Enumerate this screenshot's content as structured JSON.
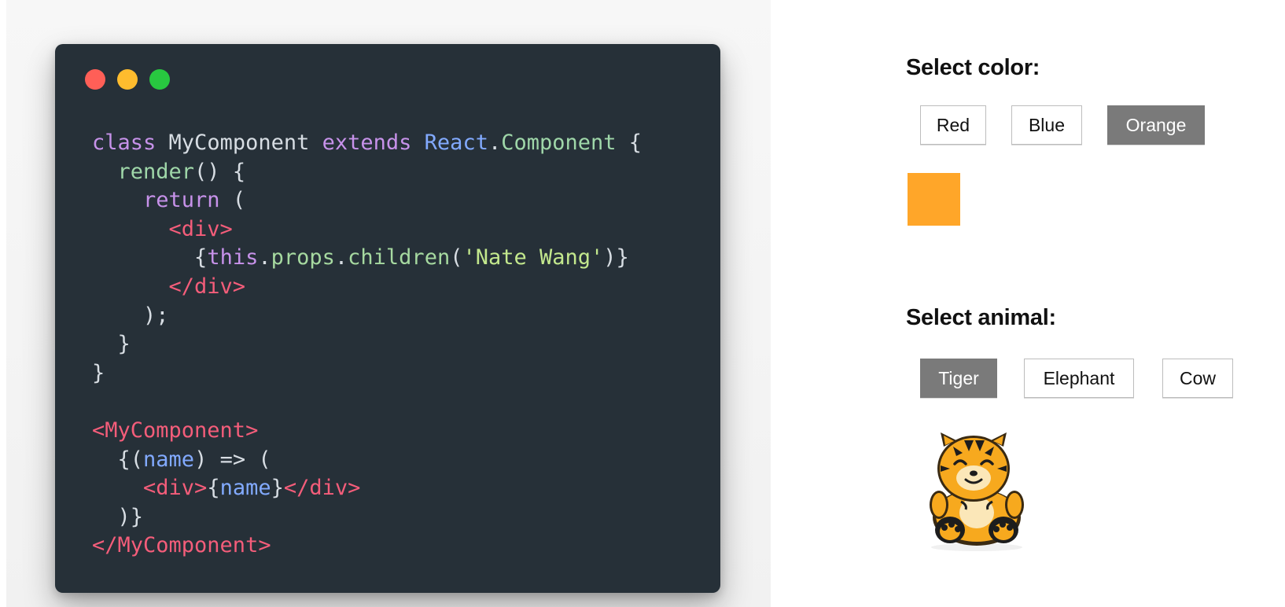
{
  "code_window": {
    "traffic_lights": [
      {
        "name": "close",
        "color": "#ff5f57"
      },
      {
        "name": "minimize",
        "color": "#febc2e"
      },
      {
        "name": "maximize",
        "color": "#28c840"
      }
    ],
    "lines": [
      [
        {
          "t": "class ",
          "c": "keyword"
        },
        {
          "t": "MyComponent ",
          "c": "plain"
        },
        {
          "t": "extends ",
          "c": "keyword"
        },
        {
          "t": "React",
          "c": "class"
        },
        {
          "t": ".",
          "c": "punct"
        },
        {
          "t": "Component",
          "c": "func"
        },
        {
          "t": " {",
          "c": "punct"
        }
      ],
      [
        {
          "t": "  render",
          "c": "func"
        },
        {
          "t": "() {",
          "c": "punct"
        }
      ],
      [
        {
          "t": "    return ",
          "c": "keyword"
        },
        {
          "t": "(",
          "c": "punct"
        }
      ],
      [
        {
          "t": "      <div>",
          "c": "tag"
        }
      ],
      [
        {
          "t": "        {",
          "c": "punct"
        },
        {
          "t": "this",
          "c": "keyword"
        },
        {
          "t": ".",
          "c": "punct"
        },
        {
          "t": "props",
          "c": "prop"
        },
        {
          "t": ".",
          "c": "punct"
        },
        {
          "t": "children",
          "c": "prop"
        },
        {
          "t": "(",
          "c": "punct"
        },
        {
          "t": "'Nate Wang'",
          "c": "string"
        },
        {
          "t": ")}",
          "c": "punct"
        }
      ],
      [
        {
          "t": "      </div>",
          "c": "tag"
        }
      ],
      [
        {
          "t": "    );",
          "c": "punct"
        }
      ],
      [
        {
          "t": "  }",
          "c": "punct"
        }
      ],
      [
        {
          "t": "}",
          "c": "punct"
        }
      ],
      [
        {
          "t": "",
          "c": "plain"
        }
      ],
      [
        {
          "t": "<MyComponent>",
          "c": "tag"
        }
      ],
      [
        {
          "t": "  {(",
          "c": "punct"
        },
        {
          "t": "name",
          "c": "param"
        },
        {
          "t": ") => (",
          "c": "punct"
        }
      ],
      [
        {
          "t": "    <div>",
          "c": "tag"
        },
        {
          "t": "{",
          "c": "punct"
        },
        {
          "t": "name",
          "c": "param"
        },
        {
          "t": "}",
          "c": "punct"
        },
        {
          "t": "</div>",
          "c": "tag"
        }
      ],
      [
        {
          "t": "  )}",
          "c": "punct"
        }
      ],
      [
        {
          "t": "</MyComponent>",
          "c": "tag"
        }
      ]
    ]
  },
  "color_section": {
    "label": "Select color:",
    "options": [
      "Red",
      "Blue",
      "Orange"
    ],
    "selected": "Orange",
    "swatch_color": "#ffa629"
  },
  "animal_section": {
    "label": "Select animal:",
    "options": [
      "Tiger",
      "Elephant",
      "Cow"
    ],
    "selected": "Tiger",
    "image": "tiger-illustration"
  },
  "colors": {
    "window_bg": "#263038",
    "button_active_bg": "#7a7a7a",
    "accent_orange": "#ffa629"
  }
}
